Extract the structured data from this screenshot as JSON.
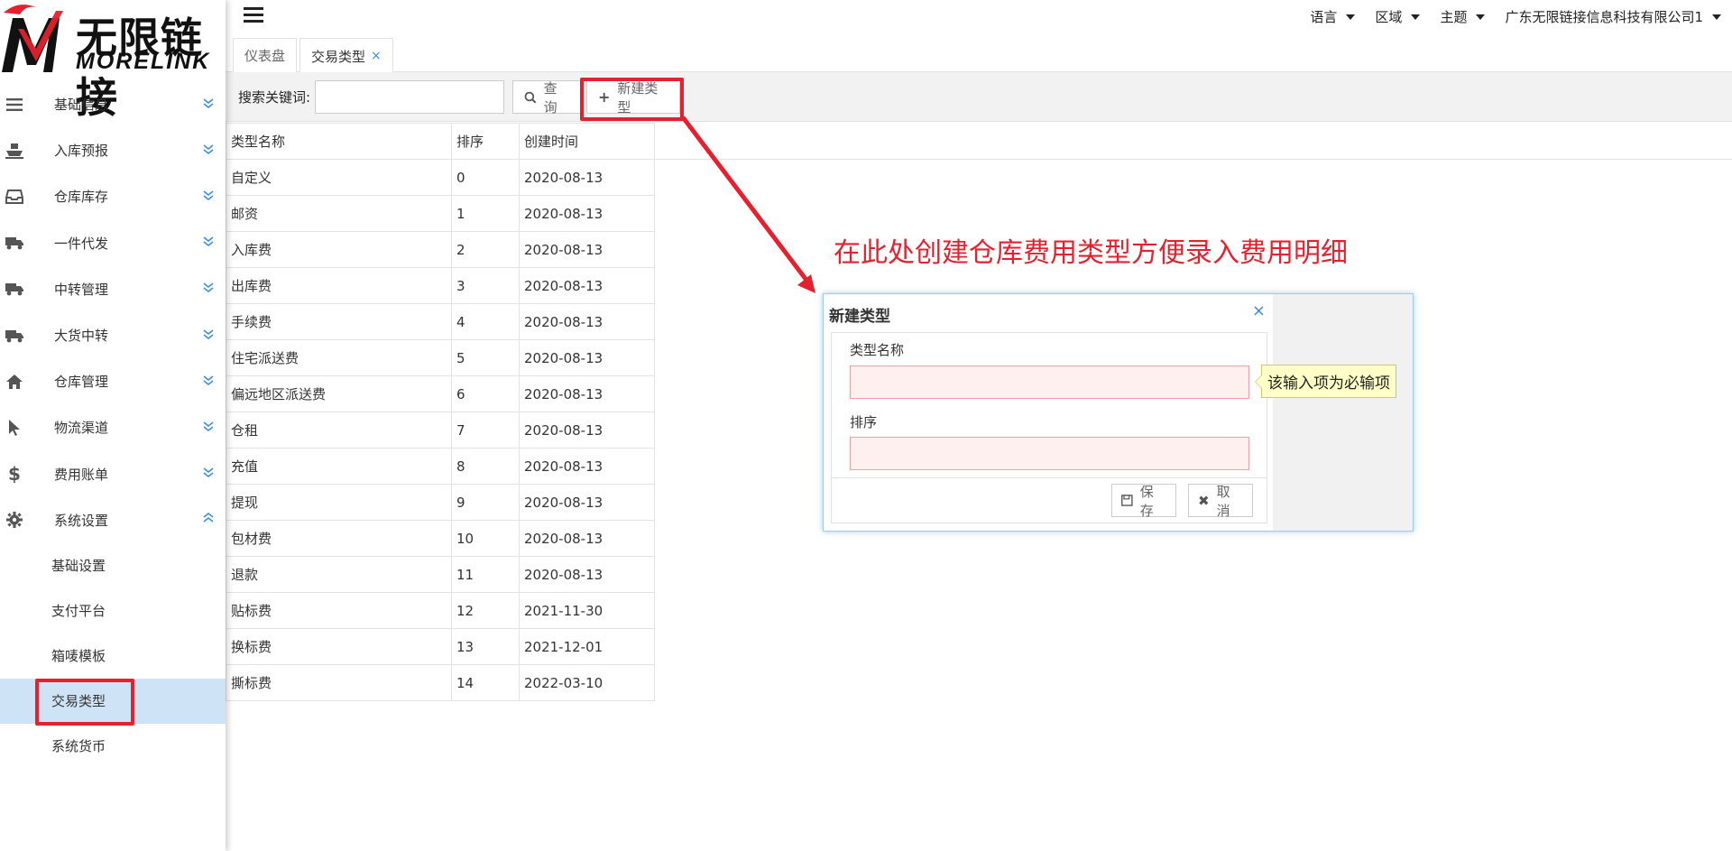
{
  "logo": {
    "cn": "无限链接",
    "en": "MORELINK"
  },
  "sidebar": {
    "items": [
      {
        "label": "基础信息",
        "icon": "menu-lines-icon"
      },
      {
        "label": "入库预报",
        "icon": "ship-icon"
      },
      {
        "label": "仓库库存",
        "icon": "inbox-icon"
      },
      {
        "label": "一件代发",
        "icon": "truck-icon"
      },
      {
        "label": "中转管理",
        "icon": "truck-icon"
      },
      {
        "label": "大货中转",
        "icon": "truck-icon"
      },
      {
        "label": "仓库管理",
        "icon": "home-icon"
      },
      {
        "label": "物流渠道",
        "icon": "pointer-icon"
      },
      {
        "label": "费用账单",
        "icon": "dollar-icon"
      },
      {
        "label": "系统设置",
        "icon": "gear-icon"
      }
    ],
    "subitems": [
      {
        "label": "基础设置"
      },
      {
        "label": "支付平台"
      },
      {
        "label": "箱唛模板"
      },
      {
        "label": "交易类型"
      },
      {
        "label": "系统货币"
      }
    ]
  },
  "topbar": {
    "menus": [
      "语言",
      "区域",
      "主题",
      "广东无限链接信息科技有限公司1"
    ]
  },
  "tabs": [
    {
      "label": "仪表盘"
    },
    {
      "label": "交易类型",
      "close": "×"
    }
  ],
  "toolbar": {
    "search_label": "搜索关键词:",
    "search_value": "",
    "query_label": "查询",
    "new_label": "新建类型"
  },
  "table": {
    "headers": [
      "类型名称",
      "排序",
      "创建时间"
    ],
    "rows": [
      [
        "自定义",
        "0",
        "2020-08-13"
      ],
      [
        "邮资",
        "1",
        "2020-08-13"
      ],
      [
        "入库费",
        "2",
        "2020-08-13"
      ],
      [
        "出库费",
        "3",
        "2020-08-13"
      ],
      [
        "手续费",
        "4",
        "2020-08-13"
      ],
      [
        "住宅派送费",
        "5",
        "2020-08-13"
      ],
      [
        "偏远地区派送费",
        "6",
        "2020-08-13"
      ],
      [
        "仓租",
        "7",
        "2020-08-13"
      ],
      [
        "充值",
        "8",
        "2020-08-13"
      ],
      [
        "提现",
        "9",
        "2020-08-13"
      ],
      [
        "包材费",
        "10",
        "2020-08-13"
      ],
      [
        "退款",
        "11",
        "2020-08-13"
      ],
      [
        "贴标费",
        "12",
        "2021-11-30"
      ],
      [
        "换标费",
        "13",
        "2021-12-01"
      ],
      [
        "撕标费",
        "14",
        "2022-03-10"
      ]
    ]
  },
  "annotation": "在此处创建仓库费用类型方便录入费用明细",
  "dialog": {
    "title": "新建类型",
    "close": "×",
    "name_label": "类型名称",
    "name_value": "",
    "sort_label": "排序",
    "sort_value": "",
    "tooltip": "该输入项为必输项",
    "save_label": "保存",
    "cancel_label": "取消"
  },
  "colors": {
    "accent": "#3a8ee6",
    "highlight_red": "#e4212e",
    "active_bg": "#cfe3f7"
  }
}
